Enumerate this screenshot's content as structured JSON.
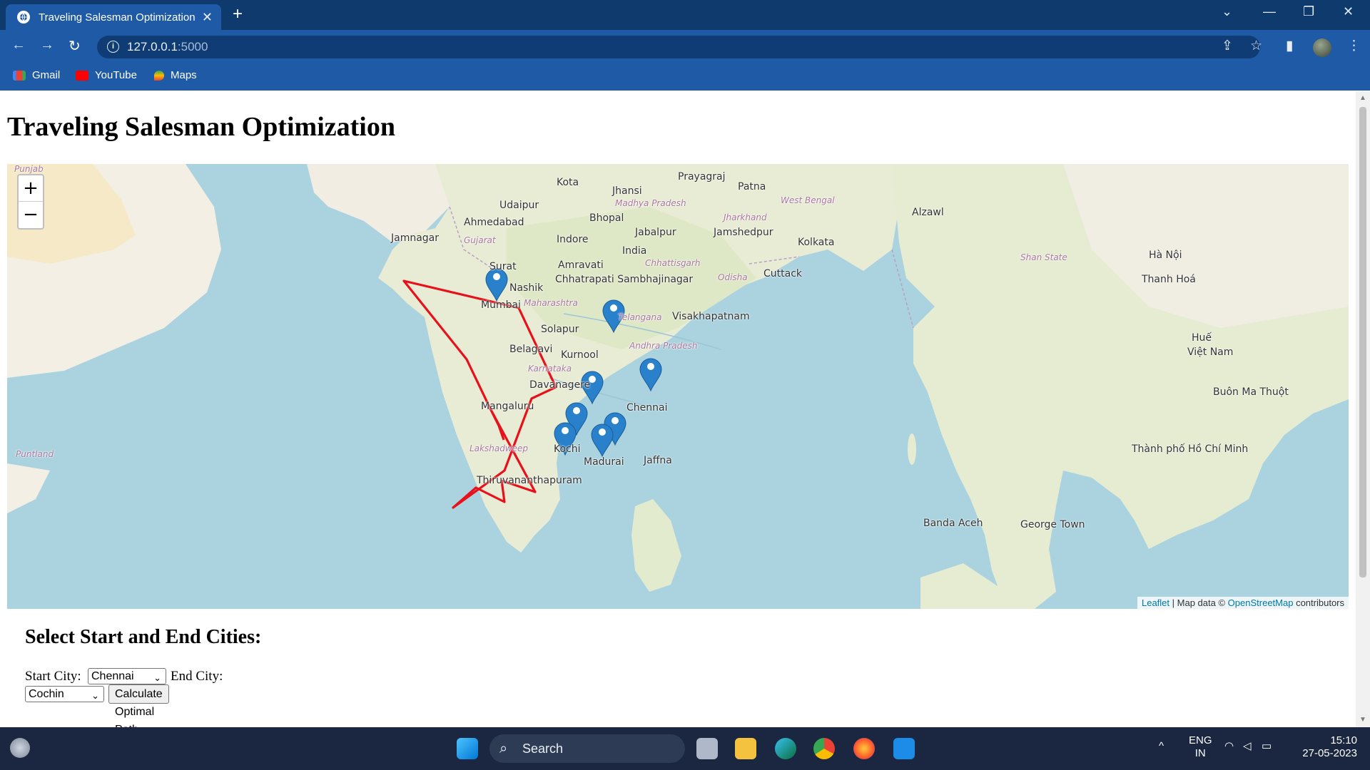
{
  "browser": {
    "tab_title": "Traveling Salesman Optimization",
    "url_host": "127.0.0.1",
    "url_port": ":5000",
    "bookmarks": [
      "Gmail",
      "YouTube",
      "Maps"
    ]
  },
  "page": {
    "title": "Traveling Salesman Optimization",
    "form_heading": "Select Start and End Cities:",
    "start_label": "Start City:",
    "start_value": "Chennai",
    "end_label": "End City:",
    "end_value": "Cochin",
    "calc_button": "Calculate Optimal Path"
  },
  "map": {
    "zoom_in": "+",
    "zoom_out": "−",
    "attribution_leaflet": "Leaflet",
    "attribution_text": "| Map data ©",
    "attribution_osm": "OpenStreetMap",
    "attribution_tail": "contributors",
    "route_color": "#e8101a",
    "marker_color": "#2a81cb",
    "place_labels": [
      "Prayagraj",
      "Patna",
      "Kota",
      "Jhansi",
      "Udaipur",
      "Bhopal",
      "Ahmedabad",
      "Jamnagar",
      "Indore",
      "Jabalpur",
      "Jamshedpur",
      "Kolkata",
      "India",
      "Surat",
      "Nashik",
      "Amravati",
      "Chhatrapati Sambhajinagar",
      "Cuttack",
      "Mumbai",
      "Solapur",
      "Visakhapatnam",
      "Belagavi",
      "Kurnool",
      "Davanagere",
      "Chennai",
      "Mangaluru",
      "Kochi",
      "Madurai",
      "Jaffna",
      "Thiruvananthapuram",
      "Banda Aceh",
      "George Town",
      "Alzawl",
      "Hà Nội",
      "Thanh Hoá",
      "Huế",
      "Việt Nam",
      "Buôn Ma Thuột",
      "Thành phố Hồ Chí Minh",
      "Gujarat",
      "Maharashtra",
      "Chhattisgarh",
      "Odisha",
      "Madhya Pradesh",
      "Jharkhand",
      "West Bengal",
      "Karnataka",
      "Andhra Pradesh",
      "Lakshadweep",
      "Telangana",
      "Shan State",
      "Punjab",
      "Puntland"
    ]
  },
  "taskbar": {
    "search_placeholder": "Search",
    "lang_top": "ENG",
    "lang_bottom": "IN",
    "time": "15:10",
    "date": "27-05-2023"
  }
}
